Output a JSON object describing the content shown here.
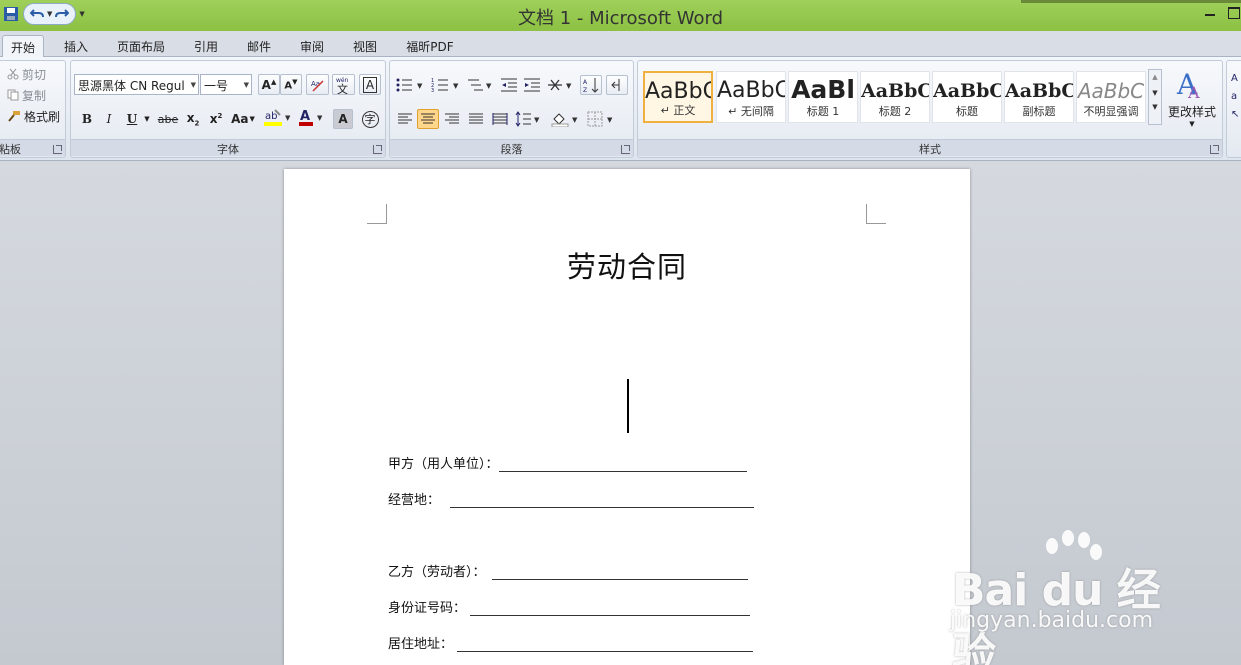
{
  "window": {
    "title": "文档 1 - Microsoft Word"
  },
  "tabs": [
    "开始",
    "插入",
    "页面布局",
    "引用",
    "邮件",
    "审阅",
    "视图",
    "福昕PDF"
  ],
  "clipboard": {
    "cut": "剪切",
    "copy": "复制",
    "format_painter": "格式刷",
    "label": "粘板"
  },
  "font": {
    "name": "思源黑体 CN Regul",
    "size": "一号",
    "label": "字体",
    "wen": "wén\n文"
  },
  "paragraph": {
    "label": "段落"
  },
  "styles": {
    "label": "样式",
    "items": [
      {
        "sample": "AaBbC",
        "name": "↵ 正文"
      },
      {
        "sample": "AaBbC",
        "name": "↵ 无间隔"
      },
      {
        "sample": "AaBl",
        "name": "标题 1"
      },
      {
        "sample": "AaBbC",
        "name": "标题 2"
      },
      {
        "sample": "AaBbC",
        "name": "标题"
      },
      {
        "sample": "AaBbC",
        "name": "副标题"
      },
      {
        "sample": "AaBbC",
        "name": "不明显强调"
      }
    ],
    "change_styles": "更改样式"
  },
  "document": {
    "title": "劳动合同",
    "fields": [
      {
        "label": "甲方（用人单位）："
      },
      {
        "label": "经营地："
      },
      {
        "label": "乙方（劳动者）："
      },
      {
        "label": "身份证号码："
      },
      {
        "label": "居住地址："
      }
    ]
  },
  "watermark": {
    "brand": "Bai du 经验",
    "url": "jingyan.baidu.com"
  }
}
